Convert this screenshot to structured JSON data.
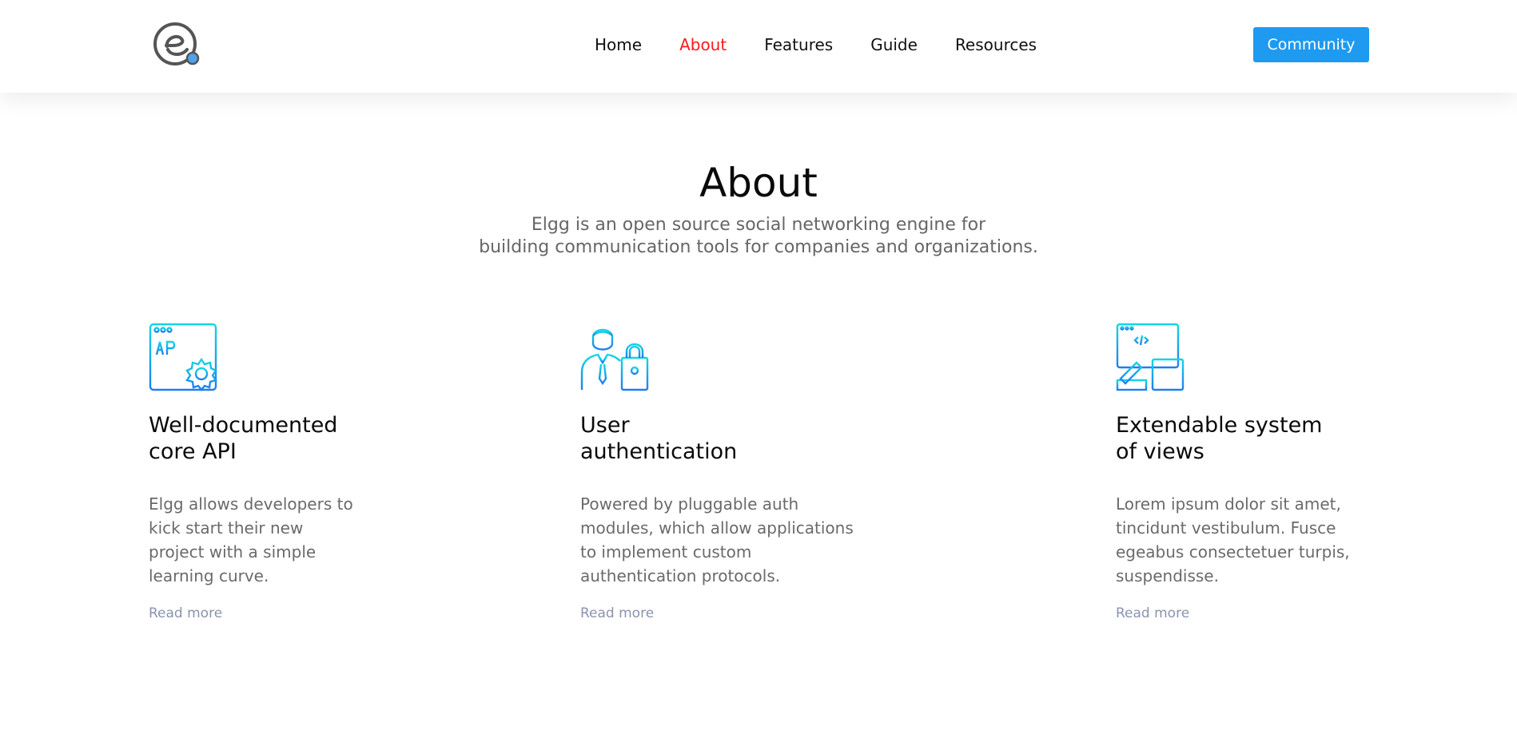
{
  "header": {
    "logo_icon": "elgg-logo-icon",
    "nav": [
      {
        "label": "Home"
      },
      {
        "label": "About",
        "active": true
      },
      {
        "label": "Features"
      },
      {
        "label": "Guide"
      },
      {
        "label": "Resources"
      }
    ],
    "community_label": "Community"
  },
  "hero": {
    "title": "About",
    "subtitle_line1": "Elgg is an open source social networking engine for",
    "subtitle_line2": "building communication tools for companies and organizations."
  },
  "cards": [
    {
      "icon": "api-gear-icon",
      "title_line1": "Well-documented",
      "title_line2": "core API",
      "text": [
        "Elgg allows developers to",
        "kick start their new",
        "project with a simple",
        "learning curve."
      ],
      "link": "Read more"
    },
    {
      "icon": "user-lock-icon",
      "title_line1": "User",
      "title_line2": "authentication",
      "text": [
        "Powered by pluggable auth",
        "modules, which allow applications",
        "to implement custom",
        "authentication protocols."
      ],
      "link": "Read more"
    },
    {
      "icon": "code-views-icon",
      "title_line1": "Extendable system",
      "title_line2": "of views",
      "text": [
        "Lorem ipsum dolor sit amet,",
        "tincidunt vestibulum. Fusce",
        "egeabus consectetuer turpis,",
        "suspendisse."
      ],
      "link": "Read more"
    }
  ],
  "colors": {
    "accent": "#1e9af0",
    "active_nav": "#ff1a1a",
    "icon_gradient_start": "#14d6e6",
    "icon_gradient_end": "#1e7ef0",
    "link": "#8a93b0"
  }
}
